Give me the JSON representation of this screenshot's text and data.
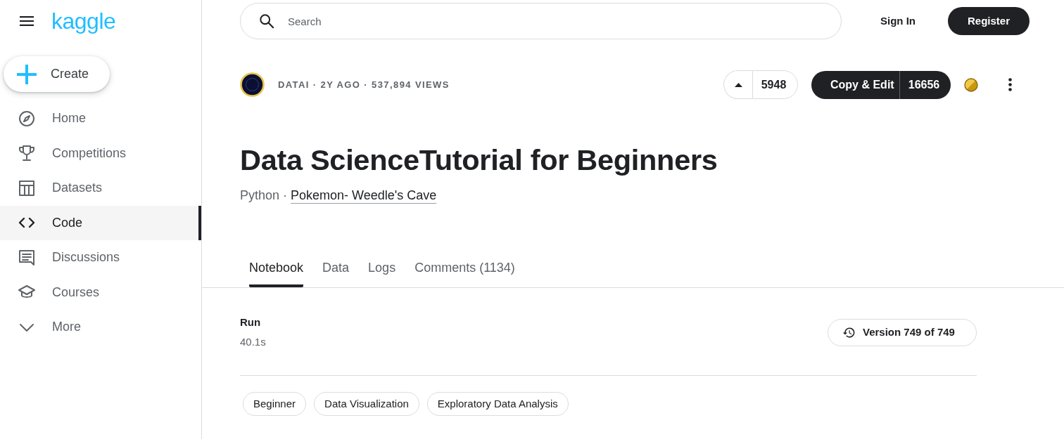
{
  "sidebar": {
    "logo": "kaggle",
    "create_button": "Create",
    "items": [
      {
        "label": "Home",
        "selected": false
      },
      {
        "label": "Competitions",
        "selected": false
      },
      {
        "label": "Datasets",
        "selected": false
      },
      {
        "label": "Code",
        "selected": true
      },
      {
        "label": "Discussions",
        "selected": false
      },
      {
        "label": "Courses",
        "selected": false
      },
      {
        "label": "More",
        "selected": false
      }
    ]
  },
  "top_bar": {
    "search": {
      "placeholder": "Search"
    },
    "sign_in": "Sign In",
    "register": "Register"
  },
  "notebook": {
    "meta": "DATAI · 2Y AGO · 537,894 VIEWS",
    "upvotes": "5948",
    "copy_edit": {
      "label": "Copy & Edit",
      "count": "16656"
    },
    "title": "Data ScienceTutorial for Beginners",
    "language": "Python",
    "separator": "·",
    "dataset": "Pokemon- Weedle's Cave"
  },
  "tabs": [
    {
      "label": "Notebook",
      "selected": true
    },
    {
      "label": "Data",
      "selected": false
    },
    {
      "label": "Logs",
      "selected": false
    },
    {
      "label": "Comments (1134)",
      "selected": false
    }
  ],
  "run": {
    "label": "Run",
    "duration": "40.1s"
  },
  "version_button": "Version 749 of 749",
  "tags": [
    "Beginner",
    "Data Visualization",
    "Exploratory Data Analysis"
  ]
}
